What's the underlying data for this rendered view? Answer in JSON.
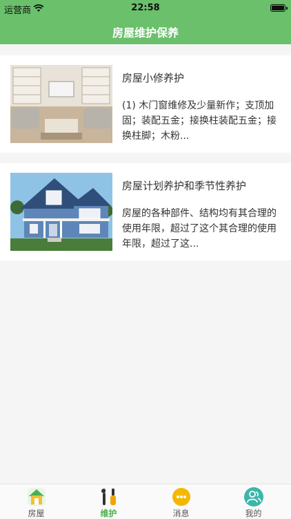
{
  "status_bar": {
    "carrier": "运营商",
    "time": "22:58"
  },
  "nav": {
    "title": "房屋维护保养"
  },
  "articles": [
    {
      "title": "房屋小修养护",
      "desc": "(1) 木门窗维修及少量新作；支顶加固；装配五金；接换柱装配五金；接换柱脚；木粉...",
      "image": "living-room-photo"
    },
    {
      "title": "房屋计划养护和季节性养护",
      "desc": "房屋的各种部件、结构均有其合理的使用年限，超过了这个其合理的使用年限，超过了这...",
      "image": "blue-house-photo"
    }
  ],
  "tabs": [
    {
      "label": "房屋",
      "icon": "house-icon",
      "active": false
    },
    {
      "label": "维护",
      "icon": "tools-icon",
      "active": true
    },
    {
      "label": "消息",
      "icon": "message-icon",
      "active": false
    },
    {
      "label": "我的",
      "icon": "profile-icon",
      "active": false
    }
  ],
  "colors": {
    "primary": "#6ac06b",
    "active_tab": "#4caf50",
    "background": "#f5f5f5"
  }
}
